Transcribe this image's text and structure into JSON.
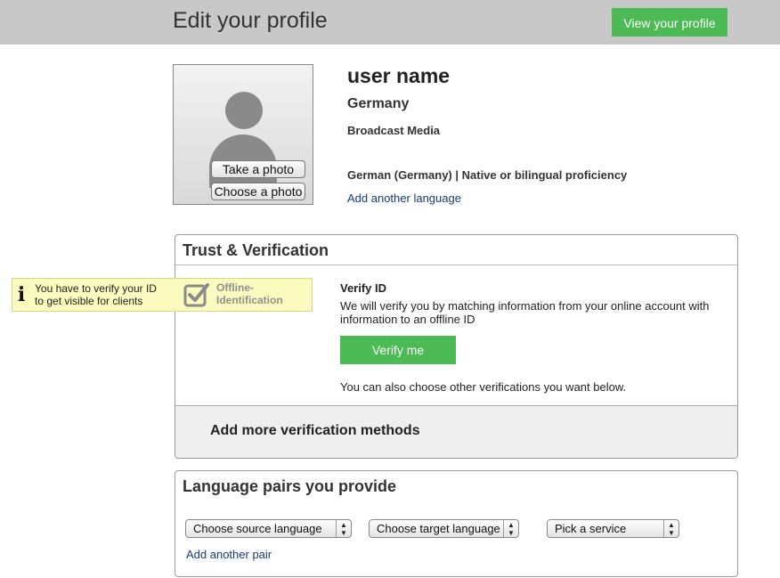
{
  "header": {
    "title": "Edit your profile",
    "view_profile_label": "View your profile"
  },
  "photo": {
    "take_label": "Take a photo",
    "choose_label": "Choose a photo"
  },
  "profile": {
    "user_name": "user name",
    "country": "Germany",
    "industry": "Broadcast Media",
    "language": "German (Germany) | Native or bilingual proficiency",
    "add_language_label": "Add another language"
  },
  "trust": {
    "title": "Trust & Verification",
    "tooltip": {
      "line1": "You have to verify your ID",
      "line2": "to get visible for clients"
    },
    "offline_label_line1": "Offline-",
    "offline_label_line2": "Identification",
    "verify_title": "Verify ID",
    "verify_desc": "We will verify you by matching information from your online account with information to an offline ID",
    "verify_button": "Verify me",
    "hint": "You can also choose other verifications you want below.",
    "more_methods": "Add more verification methods"
  },
  "language_pairs": {
    "title": "Language pairs you provide",
    "source_placeholder": "Choose source language",
    "target_placeholder": "Choose target language",
    "service_placeholder": "Pick a service",
    "add_pair_label": "Add another pair"
  },
  "colors": {
    "accent_green": "#4cba55",
    "header_gray": "#c8c8c8",
    "link_blue": "#1a3a73",
    "tooltip_yellow": "#fbfbc0"
  }
}
